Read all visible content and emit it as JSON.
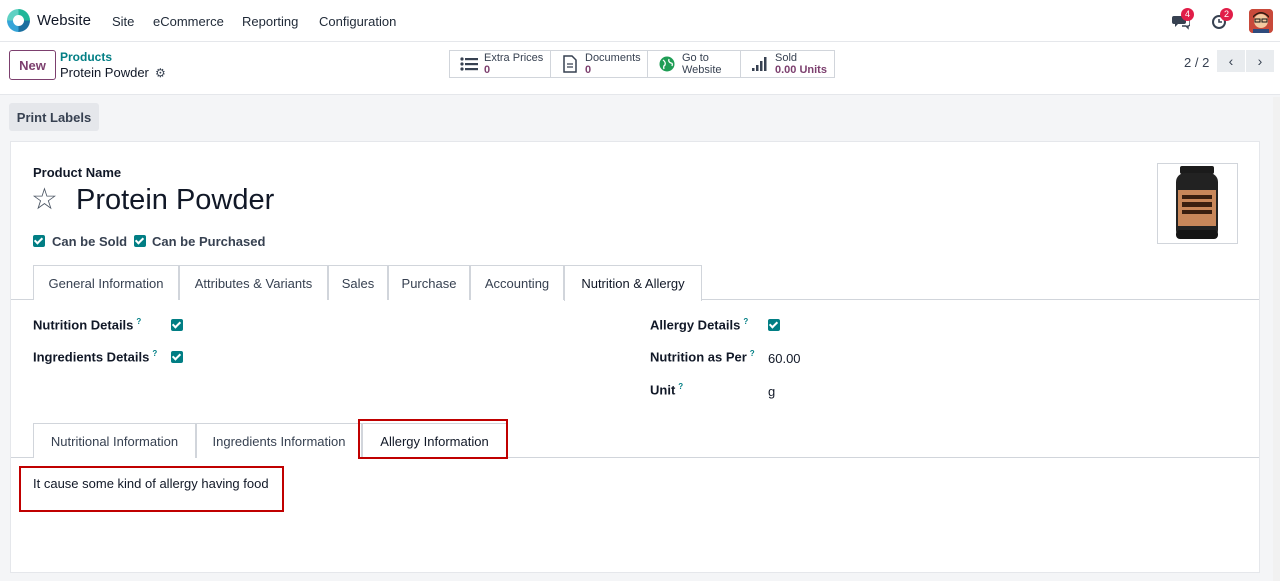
{
  "navbar": {
    "app_name": "Website",
    "menu": [
      "Site",
      "eCommerce",
      "Reporting",
      "Configuration"
    ],
    "messages_badge": "4",
    "activities_badge": "2"
  },
  "control_panel": {
    "new_label": "New",
    "breadcrumb_parent": "Products",
    "breadcrumb_current": "Protein Powder",
    "smart_buttons": [
      {
        "label": "Extra Prices",
        "value": "0"
      },
      {
        "label": "Documents",
        "value": "0"
      },
      {
        "label": "Go to",
        "value": "Website"
      },
      {
        "label": "Sold",
        "value": "0.00 Units"
      }
    ],
    "pager": "2 / 2"
  },
  "actions": {
    "print_labels": "Print Labels"
  },
  "form": {
    "product_name_label": "Product Name",
    "product_name": "Protein Powder",
    "can_be_sold": "Can be Sold",
    "can_be_purchased": "Can be Purchased",
    "tabs": [
      "General Information",
      "Attributes & Variants",
      "Sales",
      "Purchase",
      "Accounting",
      "Nutrition & Allergy"
    ],
    "nutrition_details": "Nutrition Details",
    "ingredients_details": "Ingredients Details",
    "allergy_details": "Allergy Details",
    "nutrition_as_per": "Nutrition as Per",
    "nutrition_as_per_value": "60.00",
    "unit": "Unit",
    "unit_value": "g",
    "help_mark": "?",
    "sub_tabs": [
      "Nutritional Information",
      "Ingredients Information",
      "Allergy Information"
    ],
    "allergy_note": "It cause some kind of allergy having food"
  },
  "colors": {
    "accent": "#017e84",
    "primary": "#7c3f6e",
    "highlight": "#c00000"
  }
}
